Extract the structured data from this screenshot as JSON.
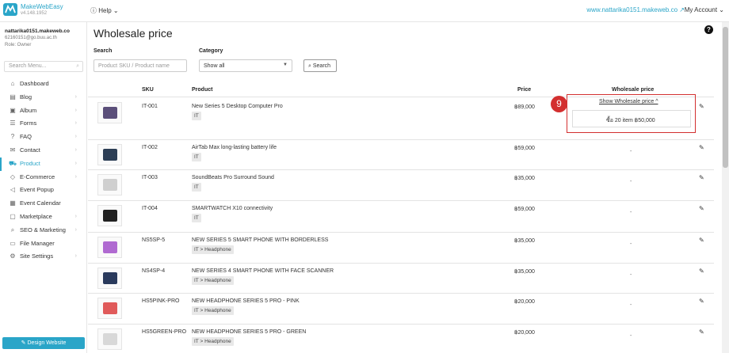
{
  "topbar": {
    "brand": "MakeWebEasy",
    "version": "v4.148.1952",
    "help": "Help",
    "site_url": "www.nattarika0151.makeweb.co",
    "account": "My Account"
  },
  "user": {
    "name": "nattarika0151.makeweb.co",
    "email": "62160151@go.buu.ac.th",
    "role": "Role: Owner"
  },
  "sidebar": {
    "search_placeholder": "Search Menu...",
    "items": [
      {
        "label": "Dashboard",
        "icon": "home-icon",
        "chevron": false
      },
      {
        "label": "Blog",
        "icon": "document-icon",
        "chevron": true
      },
      {
        "label": "Album",
        "icon": "image-icon",
        "chevron": true
      },
      {
        "label": "Forms",
        "icon": "list-icon",
        "chevron": true
      },
      {
        "label": "FAQ",
        "icon": "question-icon",
        "chevron": true
      },
      {
        "label": "Contact",
        "icon": "envelope-icon",
        "chevron": true
      },
      {
        "label": "Product",
        "icon": "cart-icon",
        "chevron": true,
        "active": true
      },
      {
        "label": "E-Commerce",
        "icon": "tag-icon",
        "chevron": true
      },
      {
        "label": "Event Popup",
        "icon": "megaphone-icon",
        "chevron": false
      },
      {
        "label": "Event Calendar",
        "icon": "calendar-icon",
        "chevron": false
      },
      {
        "label": "Marketplace",
        "icon": "bag-icon",
        "chevron": true
      },
      {
        "label": "SEO & Marketing",
        "icon": "search-icon",
        "chevron": true
      },
      {
        "label": "File Manager",
        "icon": "folder-icon",
        "chevron": false
      },
      {
        "label": "Site Settings",
        "icon": "gear-icon",
        "chevron": true
      }
    ],
    "design_button": "Design Website"
  },
  "main": {
    "title": "Wholesale price",
    "search_label": "Search",
    "search_placeholder": "Product SKU / Product name",
    "category_label": "Category",
    "category_value": "Show all",
    "search_button": "Search",
    "columns": {
      "sku": "SKU",
      "product": "Product",
      "price": "Price",
      "wholesale": "Wholesale price"
    },
    "rows": [
      {
        "sku": "IT-001",
        "product": "New Series 5 Desktop Computer Pro",
        "tag": "IT",
        "price": "฿89,000",
        "wholesale": "",
        "thumb_color": "#5b4f7a"
      },
      {
        "sku": "IT-002",
        "product": "AirTab Max long-lasting battery life",
        "tag": "IT",
        "price": "฿59,000",
        "wholesale": "-",
        "thumb_color": "#2c3e55"
      },
      {
        "sku": "IT-003",
        "product": "SoundBeats Pro Surround Sound",
        "tag": "IT",
        "price": "฿35,000",
        "wholesale": "-",
        "thumb_color": "#cfcfcf"
      },
      {
        "sku": "IT-004",
        "product": "SMARTWATCH X10 connectivity",
        "tag": "IT",
        "price": "฿59,000",
        "wholesale": "-",
        "thumb_color": "#222222"
      },
      {
        "sku": "NS5SP-5",
        "product": "NEW SERIES 5 SMART PHONE WITH BORDERLESS",
        "tag": "IT > Headphone",
        "price": "฿35,000",
        "wholesale": "-",
        "thumb_color": "#b06ad1"
      },
      {
        "sku": "NS4SP-4",
        "product": "NEW SERIES 4 SMART PHONE WITH FACE SCANNER",
        "tag": "IT > Headphone",
        "price": "฿35,000",
        "wholesale": "-",
        "thumb_color": "#2a3a5c"
      },
      {
        "sku": "HS5PINK-PRO",
        "product": "NEW HEADPHONE SERIES 5 PRO - PINK",
        "tag": "IT > Headphone",
        "price": "฿20,000",
        "wholesale": "-",
        "thumb_color": "#e05a5a"
      },
      {
        "sku": "HS5GREEN-PRO",
        "product": "NEW HEADPHONE SERIES 5 PRO - GREEN",
        "tag": "IT > Headphone",
        "price": "฿20,000",
        "wholesale": "-",
        "thumb_color": "#d8d8d8"
      }
    ],
    "wholesale_popup": {
      "link": "Show Wholesale price ^",
      "entry": "ซื้อ 20 item   ฿50,000"
    },
    "step_badge": "9"
  },
  "colors": {
    "accent": "#2aa5c8",
    "highlight": "#d32f2f"
  }
}
